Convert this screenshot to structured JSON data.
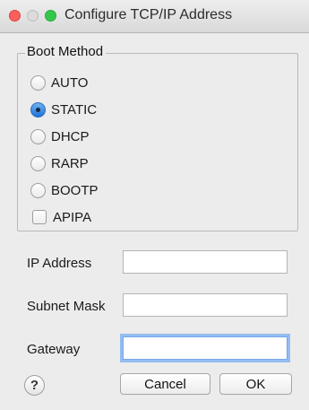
{
  "window": {
    "title": "Configure TCP/IP Address"
  },
  "boot_method": {
    "legend": "Boot Method",
    "selected": "STATIC",
    "options": [
      {
        "label": "AUTO",
        "type": "radio",
        "checked": false
      },
      {
        "label": "STATIC",
        "type": "radio",
        "checked": true
      },
      {
        "label": "DHCP",
        "type": "radio",
        "checked": false
      },
      {
        "label": "RARP",
        "type": "radio",
        "checked": false
      },
      {
        "label": "BOOTP",
        "type": "radio",
        "checked": false
      },
      {
        "label": "APIPA",
        "type": "checkbox",
        "checked": false
      }
    ]
  },
  "fields": {
    "ip_address": {
      "label": "IP Address",
      "value": ""
    },
    "subnet_mask": {
      "label": "Subnet Mask",
      "value": ""
    },
    "gateway": {
      "label": "Gateway",
      "value": "",
      "focused": true
    }
  },
  "buttons": {
    "help": "?",
    "cancel": "Cancel",
    "ok": "OK"
  },
  "colors": {
    "close": "#fc605c",
    "zoom": "#34c84a",
    "selection": "#1f73d6",
    "focus_ring": "#93bdf1"
  },
  "icons": {
    "close": "close-icon",
    "minimize": "minimize-icon",
    "zoom": "zoom-icon",
    "help": "help-icon"
  }
}
